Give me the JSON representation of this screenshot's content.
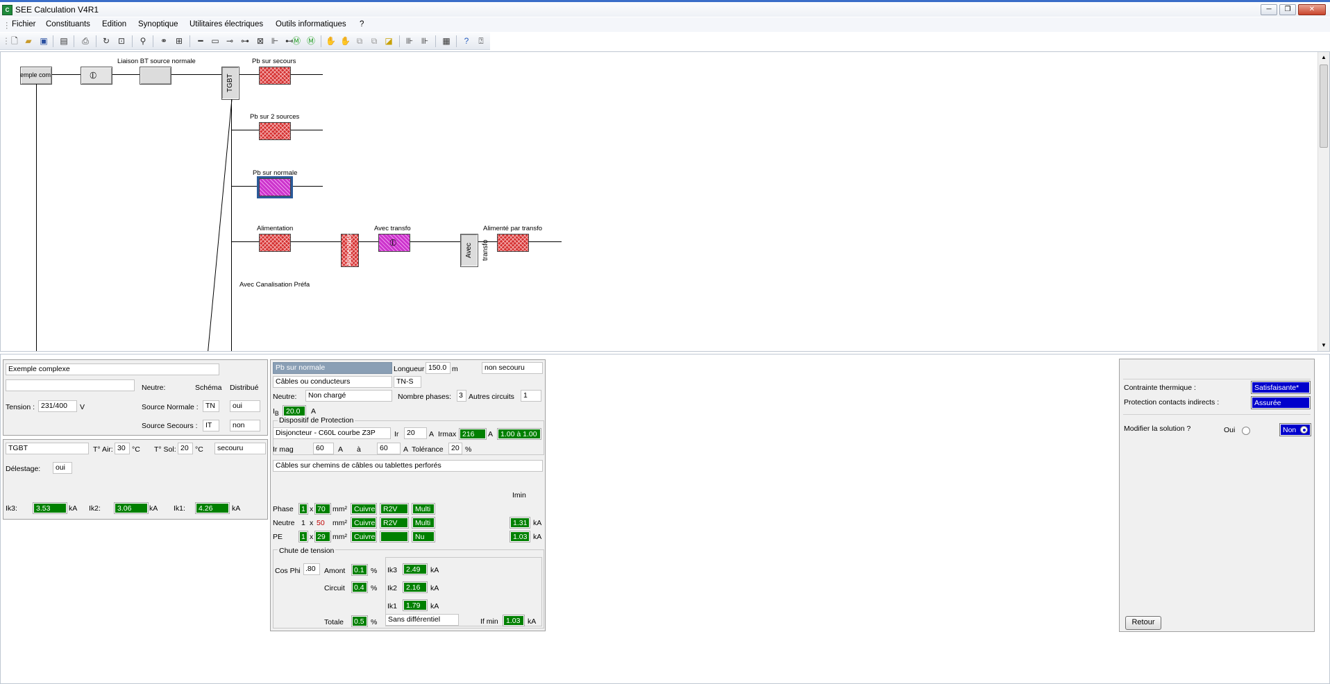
{
  "window": {
    "title": "SEE Calculation V4R1",
    "icon_text": "C",
    "min": "─",
    "max": "❐",
    "close": "✕"
  },
  "menu": [
    "Fichier",
    "Constituants",
    "Edition",
    "Synoptique",
    "Utilitaires électriques",
    "Outils informatiques",
    "?"
  ],
  "diagram": {
    "source_label": "emple com",
    "liaison_label": "Liaison BT source normale",
    "tgbt_label": "TGBT",
    "pb_secours": "Pb sur secours",
    "pb_2sources": "Pb sur 2 sources",
    "pb_normale": "Pb sur normale",
    "alimentation": "Alimentation",
    "alimentation_vertical": "Alimentation",
    "avec_transfo": "Avec transfo",
    "avec_transfo_vertical": "Avec transfo",
    "alimente_transfo": "Alimenté par transfo",
    "canalisation": "Avec Canalisation Préfa"
  },
  "left_panel": {
    "project_name": "Exemple complexe",
    "project_sub": "",
    "neutre_label": "Neutre:",
    "schema_label": "Schéma",
    "distribue_label": "Distribué",
    "tension_label": "Tension :",
    "tension_value": "231/400",
    "tension_unit": "V",
    "source_normale_label": "Source Normale :",
    "source_normale_schema": "TN",
    "source_normale_distribue": "oui",
    "source_secours_label": "Source Secours :",
    "source_secours_schema": "IT",
    "source_secours_distribue": "non"
  },
  "tgbt_panel": {
    "name": "TGBT",
    "tair_label": "T° Air:",
    "tair_value": "30",
    "tair_unit": "°C",
    "tsol_label": "T° Sol:",
    "tsol_value": "20",
    "tsol_unit": "°C",
    "secouru": "secouru",
    "delestage_label": "Délestage:",
    "delestage_value": "oui",
    "ik3_label": "Ik3:",
    "ik3_value": "3.53",
    "ik3_unit": "kA",
    "ik2_label": "Ik2:",
    "ik2_value": "3.06",
    "ik2_unit": "kA",
    "ik1_label": "Ik1:",
    "ik1_value": "4.26",
    "ik1_unit": "kA"
  },
  "circuit_panel": {
    "name": "Pb sur normale",
    "longueur_label": "Longueur",
    "longueur_value": "150.0",
    "longueur_unit": "m",
    "secouru": "non secouru",
    "type": "Câbles ou conducteurs",
    "schema": "TN-S",
    "neutre_label": "Neutre:",
    "neutre_value": "Non chargé",
    "nb_phases_label": "Nombre phases:",
    "nb_phases_value": "3",
    "autres_label": "Autres circuits",
    "autres_value": "1",
    "ib_label": "I",
    "ib_sub": "B",
    "ib_value": "20.0",
    "ib_unit": "A",
    "dispositif_label": "Dispositif de Protection",
    "dispositif_value": "Disjoncteur - C60L courbe Z3P",
    "ir_label": "Ir",
    "ir_value": "20",
    "ir_unit": "A",
    "irmax_label": "Irmax",
    "irmax_value": "216",
    "irmax_unit": "A",
    "range_value": "1.00 à 1.00",
    "irmag_label": "Ir mag",
    "irmag_from": "60",
    "irmag_unit1": "A",
    "irmag_a": "à",
    "irmag_to": "60",
    "irmag_unit2": "A",
    "tolerance_label": "Tolérance",
    "tolerance_value": "20",
    "tolerance_unit": "%",
    "pose": "Câbles sur chemins de câbles ou tablettes perforés",
    "imin_label": "Imin",
    "conductors": [
      {
        "label": "Phase",
        "n": "1",
        "x": "x",
        "section": "70",
        "unit": "mm²",
        "metal": "Cuivre",
        "isolant": "R2V",
        "type": "Multi",
        "imin": "1.31",
        "imin_unit": "kA"
      },
      {
        "label": "Neutre",
        "n": "1",
        "x": "x",
        "section": "50",
        "unit": "mm²",
        "metal": "Cuivre",
        "isolant": "R2V",
        "type": "Multi",
        "imin": "1.03",
        "imin_unit": "kA"
      },
      {
        "label": "PE",
        "n": "1",
        "x": "x",
        "section": "29",
        "unit": "mm²",
        "metal": "Cuivre",
        "isolant": "",
        "type": "Nu"
      }
    ],
    "chute_label": "Chute de tension",
    "cosphi_label": "Cos Phi",
    "cosphi_value": ".80",
    "amont_label": "Amont",
    "amont_value": "0.1",
    "amont_unit": "%",
    "circuit_label": "Circuit",
    "circuit_value": "0.4",
    "circuit_unit": "%",
    "totale_label": "Totale",
    "totale_value": "0.5",
    "totale_unit": "%",
    "ik3_label": "Ik3",
    "ik3_value": "2.49",
    "ik3_unit": "kA",
    "ik2_label": "Ik2",
    "ik2_value": "2.16",
    "ik2_unit": "kA",
    "ik1_label": "Ik1",
    "ik1_value": "1.79",
    "ik1_unit": "kA",
    "differentiel": "Sans différentiel",
    "ifmin_label": "If min",
    "ifmin_value": "1.03",
    "ifmin_unit": "kA"
  },
  "right_panel": {
    "contrainte_label": "Contrainte thermique :",
    "contrainte_value": "Satisfaisante*",
    "protection_label": "Protection contacts indirects :",
    "protection_value": "Assurée",
    "modifier_label": "Modifier la solution ?",
    "oui_label": "Oui",
    "non_label": "Non",
    "retour_label": "Retour"
  }
}
